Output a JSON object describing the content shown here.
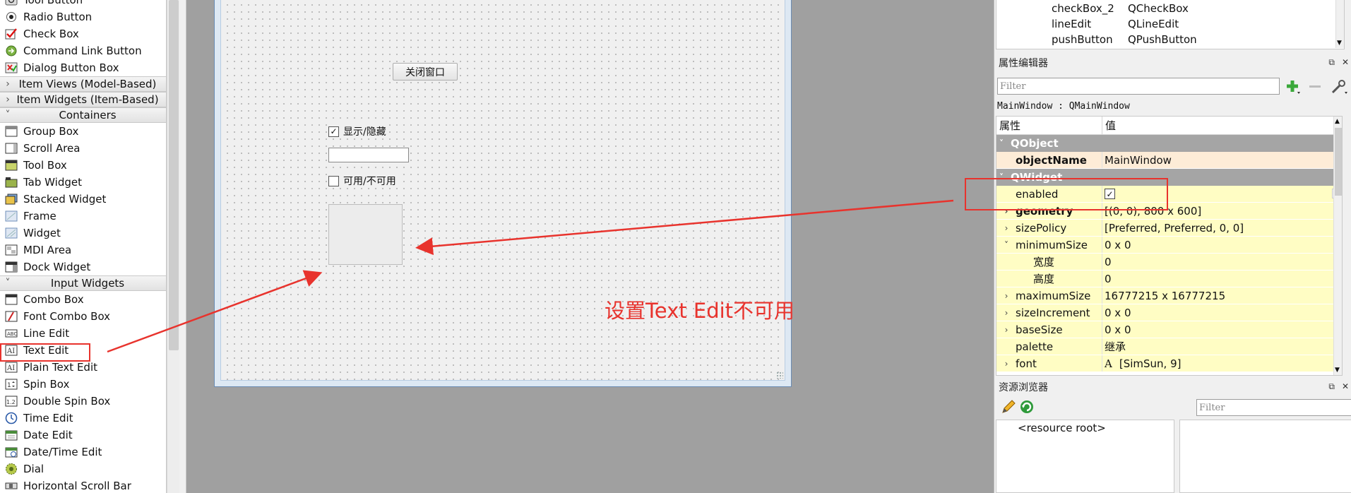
{
  "widget_box": {
    "items": [
      {
        "label": "Tool Button",
        "icon": "tool-button-icon"
      },
      {
        "label": "Radio Button",
        "icon": "radio-button-icon"
      },
      {
        "label": "Check Box",
        "icon": "check-box-icon"
      },
      {
        "label": "Command Link Button",
        "icon": "command-link-icon"
      },
      {
        "label": "Dialog Button Box",
        "icon": "dialog-button-box-icon"
      }
    ],
    "categories": {
      "item_views": "Item Views (Model-Based)",
      "item_widgets": "Item Widgets (Item-Based)",
      "containers": "Containers",
      "input_widgets": "Input Widgets"
    },
    "containers": [
      {
        "label": "Group Box",
        "icon": "group-box-icon"
      },
      {
        "label": "Scroll Area",
        "icon": "scroll-area-icon"
      },
      {
        "label": "Tool Box",
        "icon": "tool-box-icon"
      },
      {
        "label": "Tab Widget",
        "icon": "tab-widget-icon"
      },
      {
        "label": "Stacked Widget",
        "icon": "stacked-widget-icon"
      },
      {
        "label": "Frame",
        "icon": "frame-icon"
      },
      {
        "label": "Widget",
        "icon": "widget-icon"
      },
      {
        "label": "MDI Area",
        "icon": "mdi-area-icon"
      },
      {
        "label": "Dock Widget",
        "icon": "dock-widget-icon"
      }
    ],
    "inputs": [
      {
        "label": "Combo Box",
        "icon": "combo-box-icon"
      },
      {
        "label": "Font Combo Box",
        "icon": "font-combo-box-icon"
      },
      {
        "label": "Line Edit",
        "icon": "line-edit-icon"
      },
      {
        "label": "Text Edit",
        "icon": "text-edit-icon"
      },
      {
        "label": "Plain Text Edit",
        "icon": "plain-text-edit-icon"
      },
      {
        "label": "Spin Box",
        "icon": "spin-box-icon"
      },
      {
        "label": "Double Spin Box",
        "icon": "double-spin-box-icon"
      },
      {
        "label": "Time Edit",
        "icon": "time-edit-icon"
      },
      {
        "label": "Date Edit",
        "icon": "date-edit-icon"
      },
      {
        "label": "Date/Time Edit",
        "icon": "date-time-edit-icon"
      },
      {
        "label": "Dial",
        "icon": "dial-icon"
      },
      {
        "label": "Horizontal Scroll Bar",
        "icon": "horizontal-scroll-bar-icon"
      }
    ]
  },
  "form": {
    "close_button": "关闭窗口",
    "show_hide_checkbox": "显示/隐藏",
    "show_hide_checked": true,
    "enable_checkbox": "可用/不可用",
    "enable_checked": false,
    "annotation": "设置Text Edit不可用"
  },
  "object_inspector": {
    "rows": [
      {
        "name": "checkBox_2",
        "class": "QCheckBox"
      },
      {
        "name": "lineEdit",
        "class": "QLineEdit"
      },
      {
        "name": "pushButton",
        "class": "QPushButton"
      }
    ]
  },
  "property_editor": {
    "title": "属性编辑器",
    "filter_placeholder": "Filter",
    "context": "MainWindow : QMainWindow",
    "col_property": "属性",
    "col_value": "值",
    "groups": {
      "qobject": "QObject",
      "qwidget": "QWidget"
    },
    "rows": [
      {
        "name": "objectName",
        "value": "MainWindow"
      },
      {
        "name": "enabled",
        "value": "✓"
      },
      {
        "name": "geometry",
        "value": "[(0, 0), 800 x 600]"
      },
      {
        "name": "sizePolicy",
        "value": "[Preferred, Preferred, 0, 0]"
      },
      {
        "name": "minimumSize",
        "value": "0 x 0"
      },
      {
        "name": "宽度",
        "value": "0"
      },
      {
        "name": "高度",
        "value": "0"
      },
      {
        "name": "maximumSize",
        "value": "16777215 x 16777215"
      },
      {
        "name": "sizeIncrement",
        "value": "0 x 0"
      },
      {
        "name": "baseSize",
        "value": "0 x 0"
      },
      {
        "name": "palette",
        "value": "继承"
      },
      {
        "name": "font",
        "value": "[SimSun, 9]"
      }
    ],
    "font_glyph": "A"
  },
  "resource_browser": {
    "title": "资源浏览器",
    "filter_placeholder": "Filter",
    "root": "<resource root>"
  },
  "colors": {
    "annotation_red": "#e8332d",
    "group_grey": "#a5a5a5",
    "row_yellow": "#fffdc4"
  }
}
